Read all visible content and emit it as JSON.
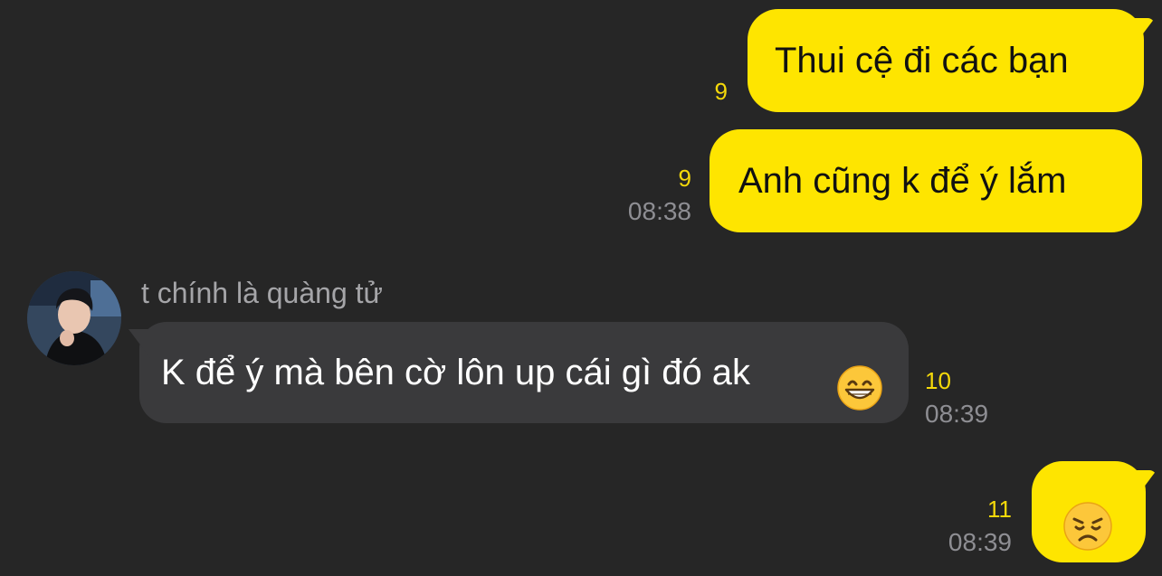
{
  "messages": {
    "m1": {
      "text": "Thui cệ đi các bạn",
      "unread": "9"
    },
    "m2": {
      "text": "Anh cũng k để ý lắm",
      "unread": "9",
      "time": "08:38"
    },
    "m3": {
      "sender": "t chính là quàng tử",
      "text": "K để ý mà bên cờ lôn up cái gì đó ak",
      "emoji": "grinning-face-emoji",
      "unread": "10",
      "time": "08:39"
    },
    "m4": {
      "emoji": "disappointed-face-emoji",
      "unread": "11",
      "time": "08:39"
    }
  },
  "colors": {
    "background": "#262626",
    "outgoing_bubble": "#fee500",
    "incoming_bubble": "#3a3a3c",
    "unread_count": "#f5d90a",
    "timestamp": "#8e8e93"
  }
}
